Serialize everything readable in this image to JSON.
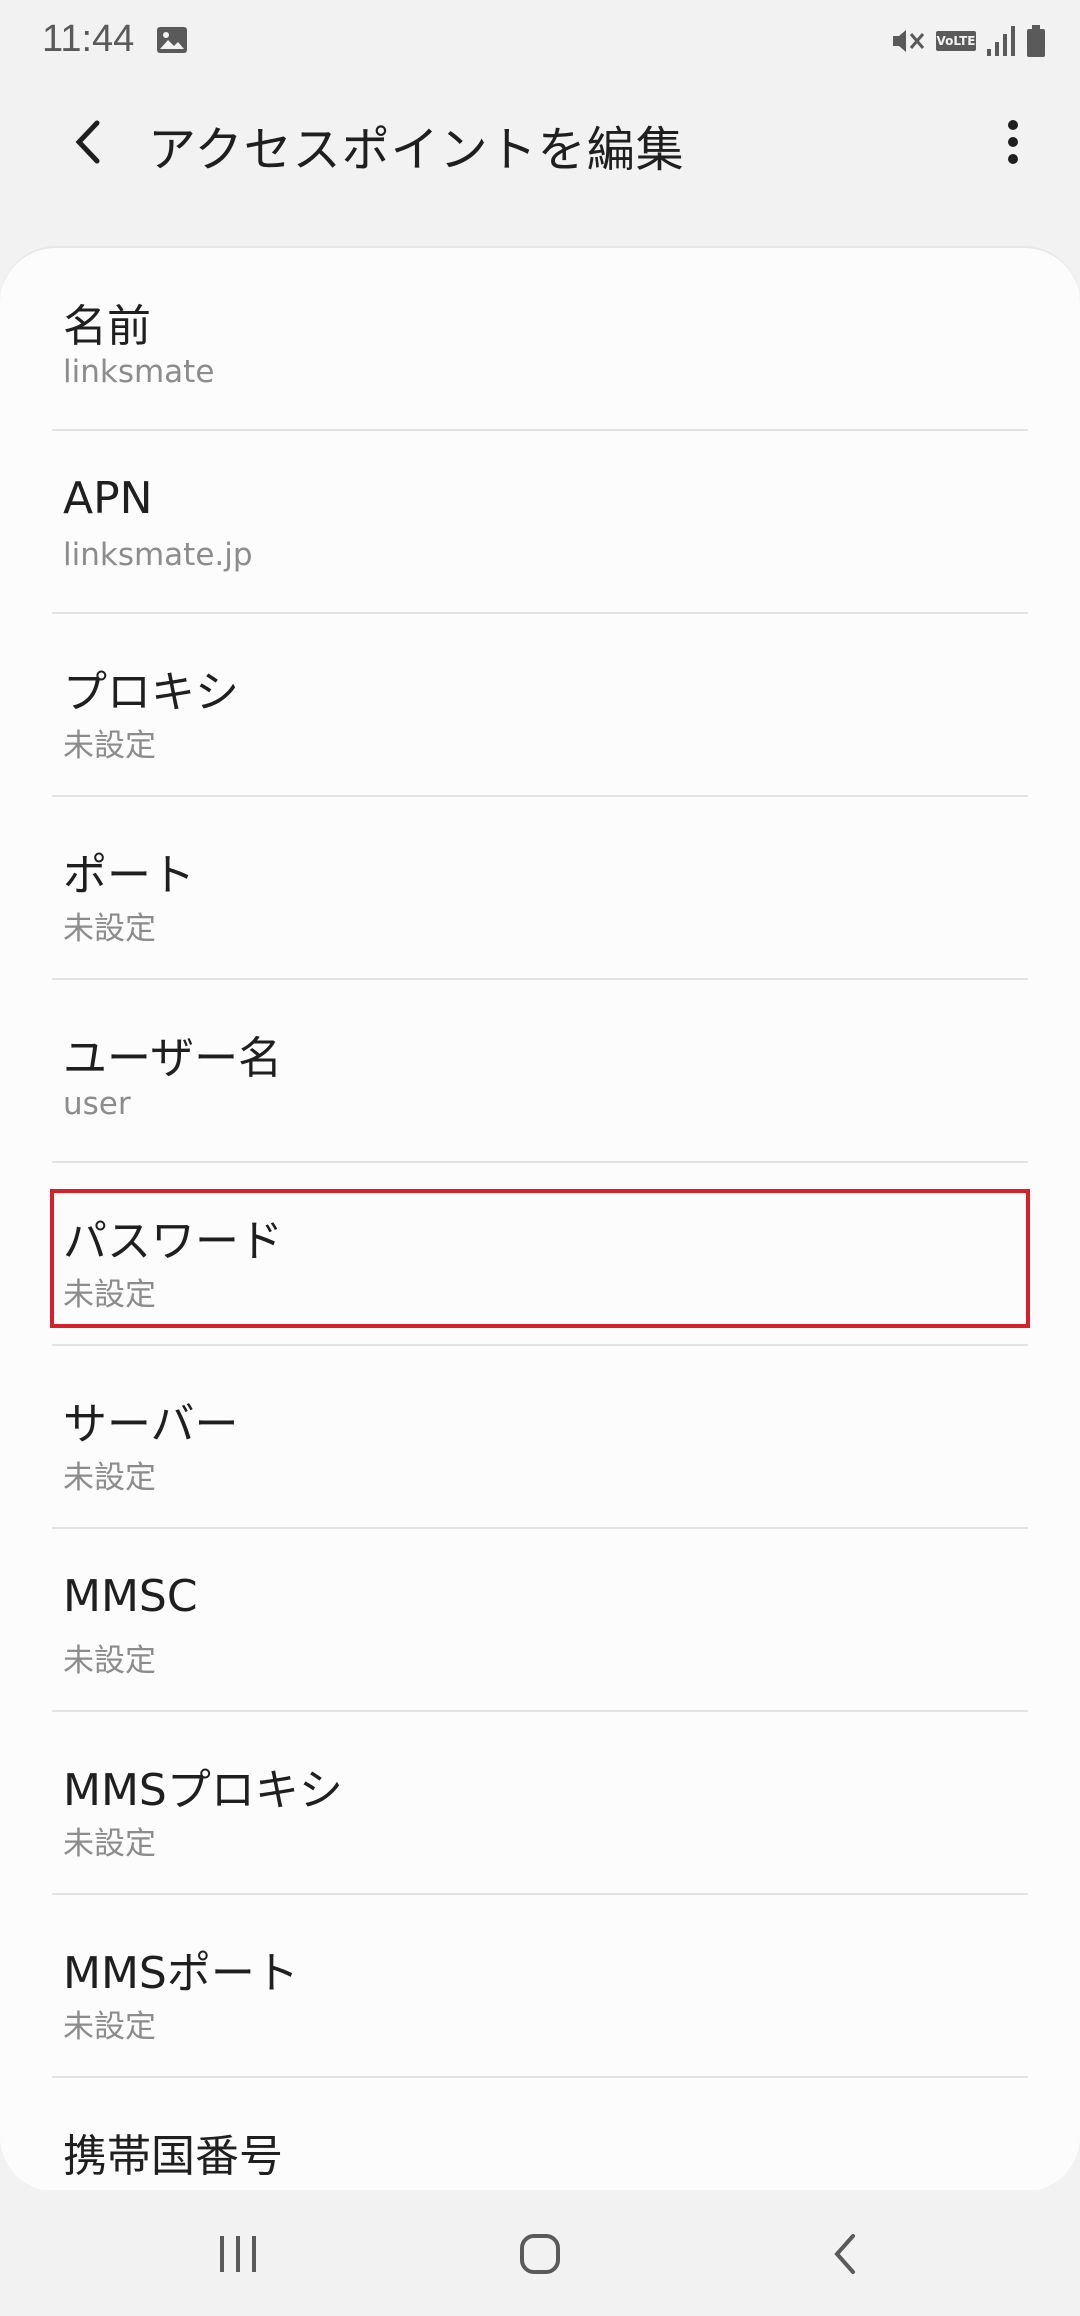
{
  "status_bar": {
    "time": "11:44",
    "icons": [
      "gallery-icon",
      "mute-vibrate-icon",
      "volte-icon",
      "signal-icon",
      "battery-icon"
    ],
    "volte_label": "VoLTE"
  },
  "app_bar": {
    "title": "アクセスポイントを編集"
  },
  "items": [
    {
      "title": "名前",
      "value": "linksmate"
    },
    {
      "title": "APN",
      "value": "linksmate.jp"
    },
    {
      "title": "プロキシ",
      "value": "未設定"
    },
    {
      "title": "ポート",
      "value": "未設定"
    },
    {
      "title": "ユーザー名",
      "value": "user"
    },
    {
      "title": "パスワード",
      "value": "未設定"
    },
    {
      "title": "サーバー",
      "value": "未設定"
    },
    {
      "title": "MMSC",
      "value": "未設定"
    },
    {
      "title": "MMSプロキシ",
      "value": "未設定"
    },
    {
      "title": "MMSポート",
      "value": "未設定"
    },
    {
      "title": "携帯国番号",
      "value": ""
    }
  ],
  "colors": {
    "background": "#f2f2f2",
    "card": "#fcfcfc",
    "highlight": "#d81f2a",
    "title_text": "#1f1f1f",
    "value_text": "#8c8c8c"
  }
}
